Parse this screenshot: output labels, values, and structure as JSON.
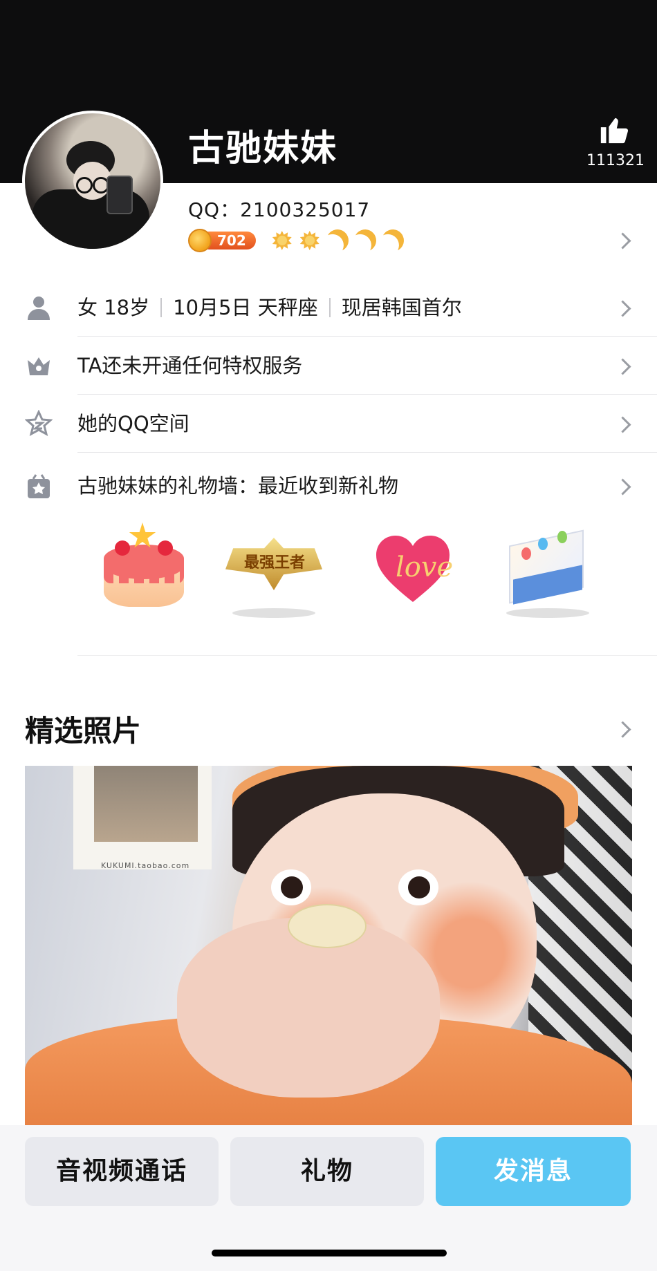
{
  "profile": {
    "nickname": "古驰妹妹",
    "like_count": "111321",
    "qq_label": "QQ：",
    "qq_number": "2100325017",
    "level_coin": "702"
  },
  "info_rows": {
    "gender": "女",
    "age": "18岁",
    "birthday": "10月5日",
    "zodiac": "天秤座",
    "location": "现居韩国首尔",
    "privilege": "TA还未开通任何特权服务",
    "qzone": "她的QQ空间",
    "gift_wall": "古驰妹妹的礼物墙：最近收到新礼物"
  },
  "gifts": {
    "items": [
      {
        "icon": "cake-gift-icon"
      },
      {
        "icon": "strongest-king-badge-icon",
        "text": "最强王者"
      },
      {
        "icon": "love-heart-balloon-icon",
        "text": "love"
      },
      {
        "icon": "birthday-card-icon"
      }
    ]
  },
  "photos": {
    "title": "精选照片",
    "poster_caption": "KUKUMI.taobao.com"
  },
  "actions": {
    "call": "音视频通话",
    "gift": "礼物",
    "message": "发消息"
  },
  "colors": {
    "header_bg": "#0d0d0e",
    "primary_button": "#5ac6f3",
    "secondary_button": "#e8e9ee",
    "level_icon": "#f4b53a"
  }
}
